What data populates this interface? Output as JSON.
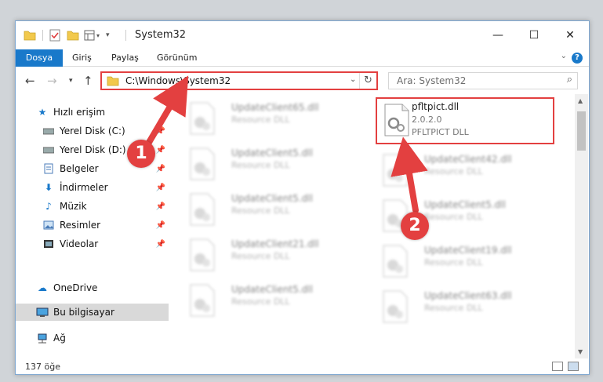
{
  "window": {
    "title": "System32",
    "controls": {
      "minimize": "—",
      "maximize": "☐",
      "close": "✕"
    }
  },
  "ribbon": {
    "tabs": [
      "Dosya",
      "Giriş",
      "Paylaş",
      "Görünüm"
    ],
    "help": "?"
  },
  "nav": {
    "address": "C:\\Windows\\System32",
    "search_placeholder": "Ara: System32"
  },
  "sidebar": {
    "items": [
      {
        "label": "Hızlı erişim",
        "icon": "star-icon"
      },
      {
        "label": "Yerel Disk (C:)",
        "icon": "drive-icon"
      },
      {
        "label": "Yerel Disk (D:)",
        "icon": "drive-icon"
      },
      {
        "label": "Belgeler",
        "icon": "documents-icon"
      },
      {
        "label": "İndirmeler",
        "icon": "download-icon"
      },
      {
        "label": "Müzik",
        "icon": "music-icon"
      },
      {
        "label": "Resimler",
        "icon": "pictures-icon"
      },
      {
        "label": "Videolar",
        "icon": "video-icon"
      },
      {
        "label": "OneDrive",
        "icon": "cloud-icon"
      },
      {
        "label": "Bu bilgisayar",
        "icon": "computer-icon"
      },
      {
        "label": "Ağ",
        "icon": "network-icon"
      }
    ]
  },
  "files": {
    "highlight": {
      "name": "pfltpict.dll",
      "version": "2.0.2.0",
      "desc": "PFLTPICT DLL"
    },
    "blurred": [
      {
        "name": "UpdateClient65.dll",
        "desc": "Resource DLL"
      },
      {
        "name": "UpdateClient5.dll",
        "desc": "Resource DLL"
      },
      {
        "name": "UpdateClient42.dll",
        "desc": "Resource DLL"
      },
      {
        "name": "UpdateClient5.dll",
        "desc": "Resource DLL"
      },
      {
        "name": "UpdateClient5.dll",
        "desc": "Resource DLL"
      },
      {
        "name": "UpdateClient21.dll",
        "desc": "Resource DLL"
      },
      {
        "name": "UpdateClient19.dll",
        "desc": "Resource DLL"
      },
      {
        "name": "UpdateClient5.dll",
        "desc": "Resource DLL"
      },
      {
        "name": "UpdateClient63.dll",
        "desc": "Resource DLL"
      }
    ]
  },
  "status": {
    "count": "137 öğe"
  },
  "callouts": {
    "one": "1",
    "two": "2"
  },
  "colors": {
    "accent": "#1979ca",
    "annotation": "#e34040"
  }
}
